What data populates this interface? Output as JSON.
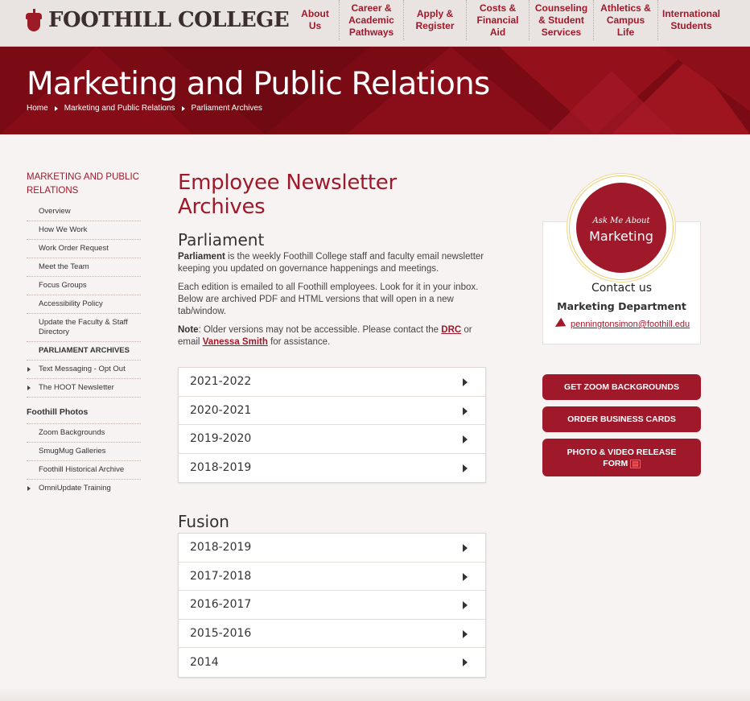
{
  "header": {
    "logo_text": "FOOTHILL COLLEGE",
    "nav": [
      {
        "label": "About Us"
      },
      {
        "label": "Career & Academic Pathways"
      },
      {
        "label": "Apply & Register"
      },
      {
        "label": "Costs & Financial Aid"
      },
      {
        "label": "Counseling & Student Services"
      },
      {
        "label": "Athletics & Campus Life"
      },
      {
        "label": "International Students"
      }
    ]
  },
  "hero": {
    "title": "Marketing and Public Relations",
    "breadcrumb": [
      "Home",
      "Marketing and Public Relations",
      "Parliament Archives"
    ]
  },
  "sidebar": {
    "title": "MARKETING AND PUBLIC RELATIONS",
    "items": [
      {
        "label": "Overview"
      },
      {
        "label": "How We Work"
      },
      {
        "label": "Work Order Request"
      },
      {
        "label": "Meet the Team"
      },
      {
        "label": "Focus Groups"
      },
      {
        "label": "Accessibility Policy"
      },
      {
        "label": "Update the Faculty & Staff Directory"
      },
      {
        "label": "PARLIAMENT ARCHIVES"
      },
      {
        "label": "Text Messaging - Opt Out"
      },
      {
        "label": "The HOOT Newsletter"
      }
    ],
    "section2_title": "Foothill Photos",
    "items2": [
      {
        "label": "Zoom Backgrounds"
      },
      {
        "label": "SmugMug Galleries"
      },
      {
        "label": "Foothill Historical Archive"
      },
      {
        "label": "OmniUpdate Training"
      }
    ]
  },
  "main": {
    "title": "Employee Newsletter Archives",
    "parliament": {
      "heading": "Parliament",
      "p1_bold": "Parliament",
      "p1_rest": " is the weekly Foothill College staff and faculty email newsletter keeping you updated on governance happenings and meetings.",
      "p2": "Each edition is emailed to all Foothill employees. Look for it in your inbox. Below are archived PDF and HTML versions that will open in a new tab/window.",
      "note_label": "Note",
      "note_a": ": Older versions may not be accessible. Please contact the ",
      "note_link1": "DRC",
      "note_b": " or email ",
      "note_link2": "Vanessa Smith",
      "note_c": " for assistance.",
      "years": [
        "2021-2022",
        "2020-2021",
        "2019-2020",
        "2018-2019"
      ]
    },
    "fusion": {
      "heading": "Fusion",
      "years": [
        "2018-2019",
        "2017-2018",
        "2016-2017",
        "2015-2016",
        "2014"
      ]
    }
  },
  "contact": {
    "badge_ask": "Ask Me About",
    "badge_topic": "Marketing",
    "heading": "Contact us",
    "department": "Marketing Department",
    "email": "penningtonsimon@foothill.edu"
  },
  "buttons": {
    "zoom": "GET ZOOM BACKGROUNDS",
    "cards": "ORDER BUSINESS CARDS",
    "release": "PHOTO & VIDEO RELEASE FORM"
  },
  "colors": {
    "brand": "#a0192a",
    "hero_bg": "#7a0b14"
  }
}
